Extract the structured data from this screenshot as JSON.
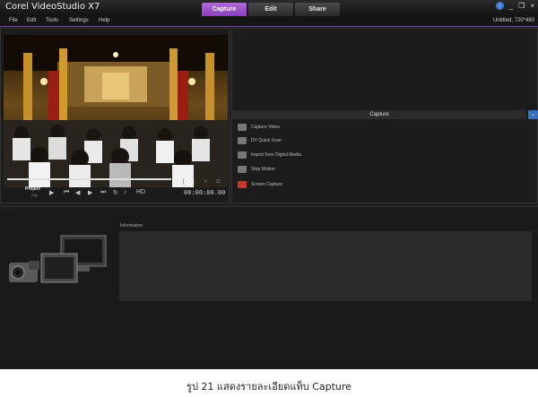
{
  "app": {
    "title": "Corel VideoStudio X7"
  },
  "tabs": [
    {
      "label": "Capture",
      "active": true
    },
    {
      "label": "Edit",
      "active": false
    },
    {
      "label": "Share",
      "active": false
    }
  ],
  "window": {
    "help": "i",
    "minimize": "_",
    "restore": "❐",
    "close": "×"
  },
  "menu": [
    "File",
    "Edit",
    "Tools",
    "Settings",
    "Help"
  ],
  "project_info": "Untitled, 720*480",
  "player": {
    "mode_label": "Project",
    "mode_sub": "Clip",
    "timecode": "00:00:00.00",
    "hd_label": "HD"
  },
  "capture_panel": {
    "header": "Capture",
    "collapse": "⌄",
    "options": [
      {
        "label": "Capture Video",
        "icon": "video-camera-icon"
      },
      {
        "label": "DV Quick Scan",
        "icon": "dv-scan-icon"
      },
      {
        "label": "Import from Digital Media",
        "icon": "import-media-icon"
      },
      {
        "label": "Stop Motion",
        "icon": "stop-motion-icon"
      },
      {
        "label": "Screen Capture",
        "icon": "screen-capture-icon"
      }
    ]
  },
  "information": {
    "label": "Information"
  },
  "caption": "รูป 21 แสดงรายละเอียดแท็บ Capture",
  "colors": {
    "accent": "#9b4fd0",
    "panel": "#1f1f1f",
    "blue": "#3a6fc0"
  }
}
